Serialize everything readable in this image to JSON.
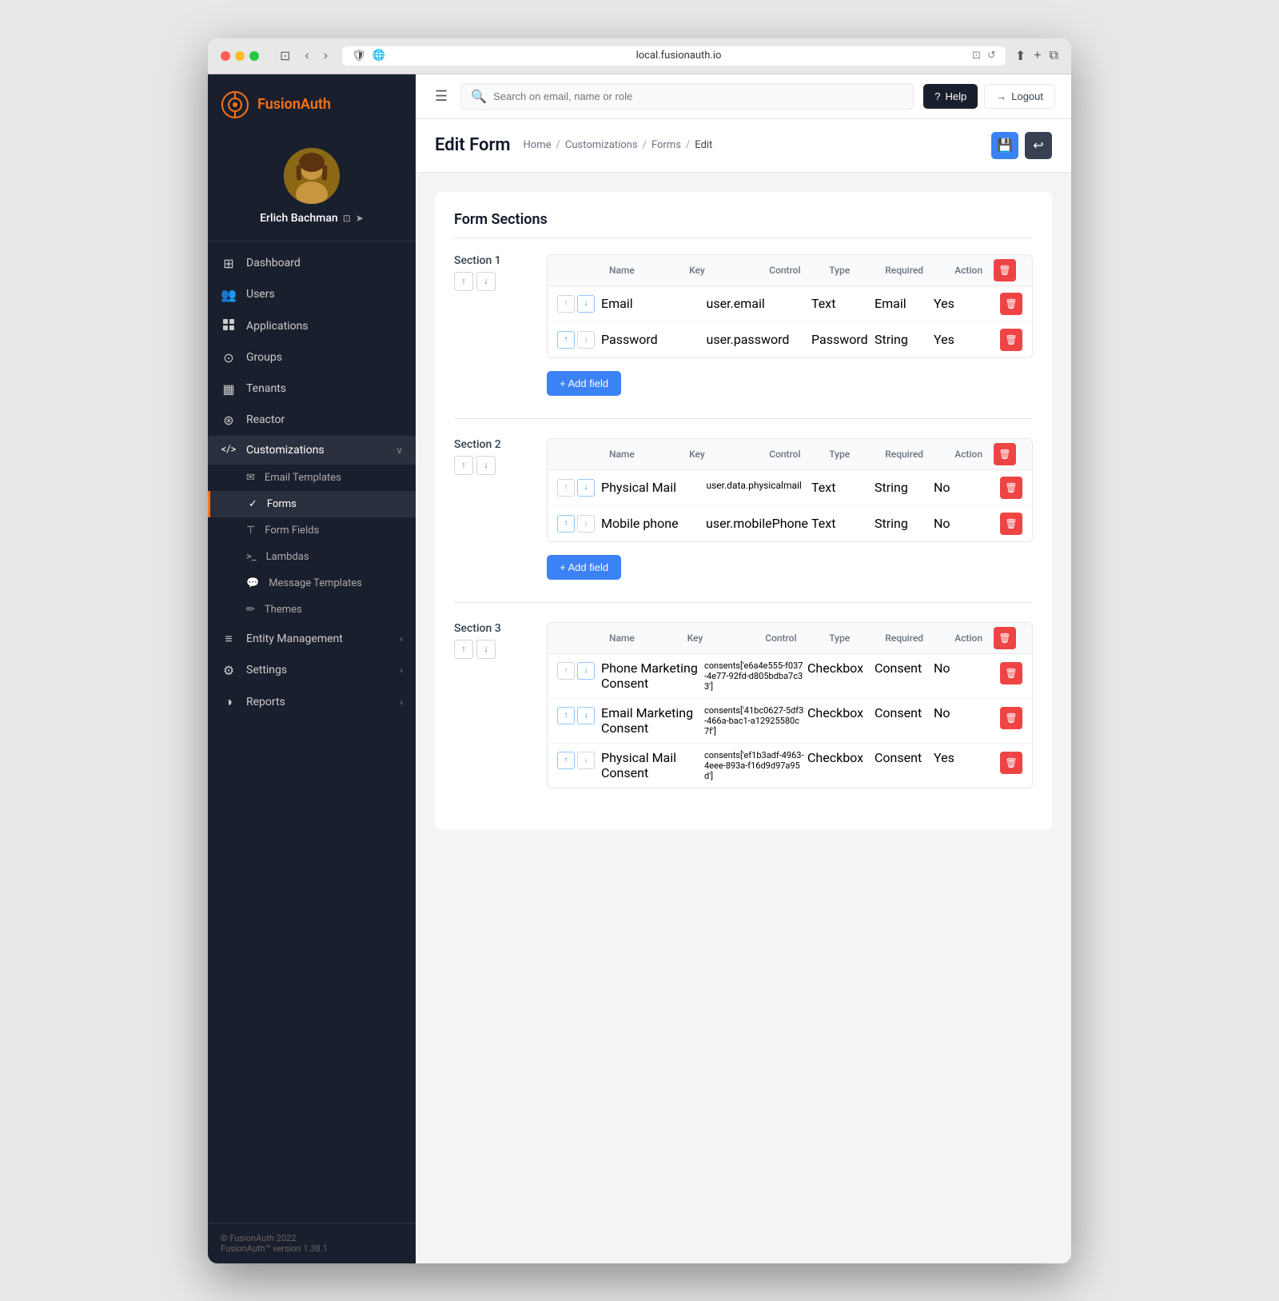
{
  "browser": {
    "url": "local.fusionauth.io"
  },
  "topbar": {
    "search_placeholder": "Search on email, name or role",
    "help_label": "Help",
    "logout_label": "Logout",
    "hamburger_icon": "☰",
    "search_icon": "🔍"
  },
  "sidebar": {
    "logo_name": "FusionAuth",
    "logo_prefix": "Fusion",
    "logo_suffix": "Auth",
    "user_name": "Erlich Bachman",
    "nav_items": [
      {
        "id": "dashboard",
        "label": "Dashboard",
        "icon": "⊞",
        "active": false
      },
      {
        "id": "users",
        "label": "Users",
        "icon": "👥",
        "active": false
      },
      {
        "id": "applications",
        "label": "Applications",
        "icon": "⊡",
        "active": false
      },
      {
        "id": "groups",
        "label": "Groups",
        "icon": "⊙",
        "active": false
      },
      {
        "id": "tenants",
        "label": "Tenants",
        "icon": "▦",
        "active": false
      },
      {
        "id": "reactor",
        "label": "Reactor",
        "icon": "⊛",
        "active": false
      },
      {
        "id": "customizations",
        "label": "Customizations",
        "icon": "</>",
        "active": true,
        "has_chevron": true
      }
    ],
    "sub_nav_items": [
      {
        "id": "email-templates",
        "label": "Email Templates",
        "icon": "✉"
      },
      {
        "id": "forms",
        "label": "Forms",
        "icon": "✓",
        "active": true
      },
      {
        "id": "form-fields",
        "label": "Form Fields",
        "icon": "⊤"
      },
      {
        "id": "lambdas",
        "label": "Lambdas",
        "icon": ">_"
      },
      {
        "id": "message-templates",
        "label": "Message Templates",
        "icon": "💬"
      },
      {
        "id": "themes",
        "label": "Themes",
        "icon": "✏"
      }
    ],
    "bottom_nav_items": [
      {
        "id": "entity-management",
        "label": "Entity Management",
        "icon": "≡",
        "has_chevron": true
      },
      {
        "id": "settings",
        "label": "Settings",
        "icon": "⚙",
        "has_chevron": true
      },
      {
        "id": "reports",
        "label": "Reports",
        "icon": "◑",
        "has_chevron": true
      }
    ],
    "footer": "© FusionAuth 2022",
    "footer2": "FusionAuth™ version 1.38.1"
  },
  "page": {
    "title": "Edit Form",
    "breadcrumb": [
      "Home",
      "Customizations",
      "Forms",
      "Edit"
    ]
  },
  "form_sections_title": "Form Sections",
  "sections": [
    {
      "id": "section1",
      "label": "Section 1",
      "has_up": false,
      "has_down": true,
      "columns": [
        "",
        "Name",
        "Key",
        "Control",
        "Type",
        "Required",
        "Action"
      ],
      "fields": [
        {
          "id": "f1",
          "up_active": false,
          "down_active": true,
          "name": "Email",
          "key": "user.email",
          "control": "Text",
          "type": "Email",
          "required": "Yes"
        },
        {
          "id": "f2",
          "up_active": true,
          "down_active": false,
          "name": "Password",
          "key": "user.password",
          "control": "Password",
          "type": "String",
          "required": "Yes"
        }
      ],
      "add_field_label": "+ Add field"
    },
    {
      "id": "section2",
      "label": "Section 2",
      "has_up": true,
      "has_down": true,
      "columns": [
        "",
        "Name",
        "Key",
        "Control",
        "Type",
        "Required",
        "Action"
      ],
      "fields": [
        {
          "id": "f3",
          "up_active": false,
          "down_active": true,
          "name": "Physical Mail",
          "key": "user.data.physicalmail",
          "control": "Text",
          "type": "String",
          "required": "No"
        },
        {
          "id": "f4",
          "up_active": true,
          "down_active": false,
          "name": "Mobile phone",
          "key": "user.mobilePhone",
          "control": "Text",
          "type": "String",
          "required": "No"
        }
      ],
      "add_field_label": "+ Add field"
    },
    {
      "id": "section3",
      "label": "Section 3",
      "has_up": true,
      "has_down": false,
      "columns": [
        "",
        "Name",
        "Key",
        "Control",
        "Type",
        "Required",
        "Action"
      ],
      "fields": [
        {
          "id": "f5",
          "up_active": false,
          "down_active": true,
          "name": "Phone Marketing Consent",
          "key": "consents['e6a4e555-f037-4e77-92fd-d805bdba7c33']",
          "control": "Checkbox",
          "type": "Consent",
          "required": "No"
        },
        {
          "id": "f6",
          "up_active": true,
          "down_active": true,
          "name": "Email Marketing Consent",
          "key": "consents['41bc0627-5df3-466a-bac1-a12925580c7f']",
          "control": "Checkbox",
          "type": "Consent",
          "required": "No"
        },
        {
          "id": "f7",
          "up_active": true,
          "down_active": false,
          "name": "Physical Mail Consent",
          "key": "consents['ef1b3adf-4963-4eee-893a-f16d9d97a95d']",
          "control": "Checkbox",
          "type": "Consent",
          "required": "Yes"
        }
      ],
      "add_field_label": "+ Add field"
    }
  ]
}
